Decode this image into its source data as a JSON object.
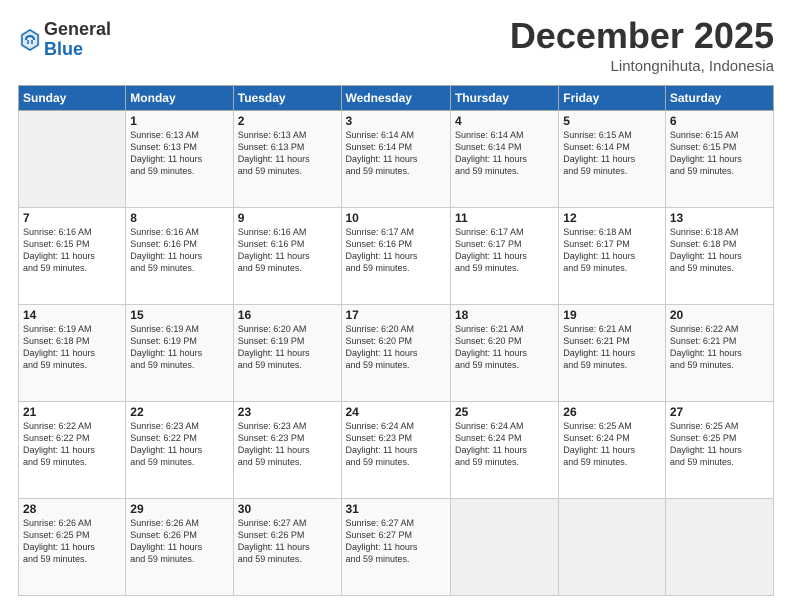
{
  "header": {
    "logo_general": "General",
    "logo_blue": "Blue",
    "month": "December 2025",
    "location": "Lintongnihuta, Indonesia"
  },
  "days_of_week": [
    "Sunday",
    "Monday",
    "Tuesday",
    "Wednesday",
    "Thursday",
    "Friday",
    "Saturday"
  ],
  "weeks": [
    [
      {
        "day": "",
        "info": ""
      },
      {
        "day": "1",
        "info": "Sunrise: 6:13 AM\nSunset: 6:13 PM\nDaylight: 11 hours\nand 59 minutes."
      },
      {
        "day": "2",
        "info": "Sunrise: 6:13 AM\nSunset: 6:13 PM\nDaylight: 11 hours\nand 59 minutes."
      },
      {
        "day": "3",
        "info": "Sunrise: 6:14 AM\nSunset: 6:14 PM\nDaylight: 11 hours\nand 59 minutes."
      },
      {
        "day": "4",
        "info": "Sunrise: 6:14 AM\nSunset: 6:14 PM\nDaylight: 11 hours\nand 59 minutes."
      },
      {
        "day": "5",
        "info": "Sunrise: 6:15 AM\nSunset: 6:14 PM\nDaylight: 11 hours\nand 59 minutes."
      },
      {
        "day": "6",
        "info": "Sunrise: 6:15 AM\nSunset: 6:15 PM\nDaylight: 11 hours\nand 59 minutes."
      }
    ],
    [
      {
        "day": "7",
        "info": "Sunrise: 6:16 AM\nSunset: 6:15 PM\nDaylight: 11 hours\nand 59 minutes."
      },
      {
        "day": "8",
        "info": "Sunrise: 6:16 AM\nSunset: 6:16 PM\nDaylight: 11 hours\nand 59 minutes."
      },
      {
        "day": "9",
        "info": "Sunrise: 6:16 AM\nSunset: 6:16 PM\nDaylight: 11 hours\nand 59 minutes."
      },
      {
        "day": "10",
        "info": "Sunrise: 6:17 AM\nSunset: 6:16 PM\nDaylight: 11 hours\nand 59 minutes."
      },
      {
        "day": "11",
        "info": "Sunrise: 6:17 AM\nSunset: 6:17 PM\nDaylight: 11 hours\nand 59 minutes."
      },
      {
        "day": "12",
        "info": "Sunrise: 6:18 AM\nSunset: 6:17 PM\nDaylight: 11 hours\nand 59 minutes."
      },
      {
        "day": "13",
        "info": "Sunrise: 6:18 AM\nSunset: 6:18 PM\nDaylight: 11 hours\nand 59 minutes."
      }
    ],
    [
      {
        "day": "14",
        "info": "Sunrise: 6:19 AM\nSunset: 6:18 PM\nDaylight: 11 hours\nand 59 minutes."
      },
      {
        "day": "15",
        "info": "Sunrise: 6:19 AM\nSunset: 6:19 PM\nDaylight: 11 hours\nand 59 minutes."
      },
      {
        "day": "16",
        "info": "Sunrise: 6:20 AM\nSunset: 6:19 PM\nDaylight: 11 hours\nand 59 minutes."
      },
      {
        "day": "17",
        "info": "Sunrise: 6:20 AM\nSunset: 6:20 PM\nDaylight: 11 hours\nand 59 minutes."
      },
      {
        "day": "18",
        "info": "Sunrise: 6:21 AM\nSunset: 6:20 PM\nDaylight: 11 hours\nand 59 minutes."
      },
      {
        "day": "19",
        "info": "Sunrise: 6:21 AM\nSunset: 6:21 PM\nDaylight: 11 hours\nand 59 minutes."
      },
      {
        "day": "20",
        "info": "Sunrise: 6:22 AM\nSunset: 6:21 PM\nDaylight: 11 hours\nand 59 minutes."
      }
    ],
    [
      {
        "day": "21",
        "info": "Sunrise: 6:22 AM\nSunset: 6:22 PM\nDaylight: 11 hours\nand 59 minutes."
      },
      {
        "day": "22",
        "info": "Sunrise: 6:23 AM\nSunset: 6:22 PM\nDaylight: 11 hours\nand 59 minutes."
      },
      {
        "day": "23",
        "info": "Sunrise: 6:23 AM\nSunset: 6:23 PM\nDaylight: 11 hours\nand 59 minutes."
      },
      {
        "day": "24",
        "info": "Sunrise: 6:24 AM\nSunset: 6:23 PM\nDaylight: 11 hours\nand 59 minutes."
      },
      {
        "day": "25",
        "info": "Sunrise: 6:24 AM\nSunset: 6:24 PM\nDaylight: 11 hours\nand 59 minutes."
      },
      {
        "day": "26",
        "info": "Sunrise: 6:25 AM\nSunset: 6:24 PM\nDaylight: 11 hours\nand 59 minutes."
      },
      {
        "day": "27",
        "info": "Sunrise: 6:25 AM\nSunset: 6:25 PM\nDaylight: 11 hours\nand 59 minutes."
      }
    ],
    [
      {
        "day": "28",
        "info": "Sunrise: 6:26 AM\nSunset: 6:25 PM\nDaylight: 11 hours\nand 59 minutes."
      },
      {
        "day": "29",
        "info": "Sunrise: 6:26 AM\nSunset: 6:26 PM\nDaylight: 11 hours\nand 59 minutes."
      },
      {
        "day": "30",
        "info": "Sunrise: 6:27 AM\nSunset: 6:26 PM\nDaylight: 11 hours\nand 59 minutes."
      },
      {
        "day": "31",
        "info": "Sunrise: 6:27 AM\nSunset: 6:27 PM\nDaylight: 11 hours\nand 59 minutes."
      },
      {
        "day": "",
        "info": ""
      },
      {
        "day": "",
        "info": ""
      },
      {
        "day": "",
        "info": ""
      }
    ]
  ]
}
